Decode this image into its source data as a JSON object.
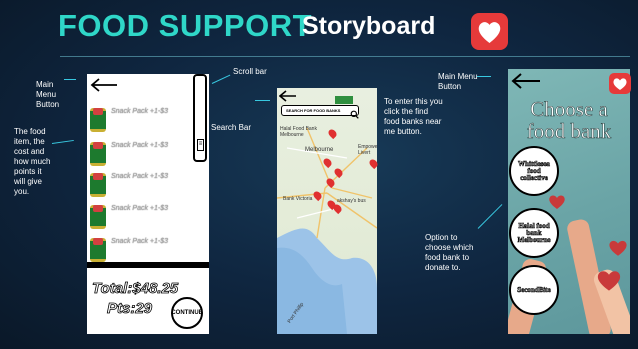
{
  "title": {
    "part1": "FOOD SUPPORT",
    "part2": "Storyboard"
  },
  "annotations": {
    "main_menu_left": "Main\nMenu\nButton",
    "food_item": "The food\nitem, the\ncost and\nhow much\npoints it\nwill give\nyou.",
    "scroll_bar": "Scroll bar",
    "search_bar": "Search Bar",
    "find_food_banks": "To enter this you\nclick the find\nfood banks near\nme button.",
    "main_menu_right": "Main Menu\nButton",
    "option_choose": "Option to\nchoose which\nfood bank to\ndonate to."
  },
  "phone1": {
    "items": [
      {
        "label": "Snack Pack  +1-$3"
      },
      {
        "label": "Snack Pack  +1-$3"
      },
      {
        "label": "Snack Pack  +1-$3"
      },
      {
        "label": "Snack Pack  +1-$3"
      },
      {
        "label": "Snack Pack  +1-$3"
      }
    ],
    "total": "Total:$48.25",
    "points": "Pts:29",
    "continue_label": "CONTINUE",
    "scroll_thumb": "≡"
  },
  "phone2": {
    "search_placeholder": "SEARCH FOR FOOD BANKS",
    "labels": {
      "halal": "Halal Food Bank\nMelbourne",
      "melbourne": "Melbourne",
      "empower": "Empowe\nLivert",
      "bank_victoria": "Bank Victoria",
      "kakshay": "akshay's bus",
      "port_phillip": "Port Phillip"
    }
  },
  "phone3": {
    "title": "Choose a food bank",
    "banks": [
      "Whittlesea food collective",
      "Halal food bank Melbourne",
      "SecondBite"
    ]
  },
  "colors": {
    "accent": "#2fd7c8",
    "heart": "#e63a3a",
    "background": "#0e1f33"
  }
}
